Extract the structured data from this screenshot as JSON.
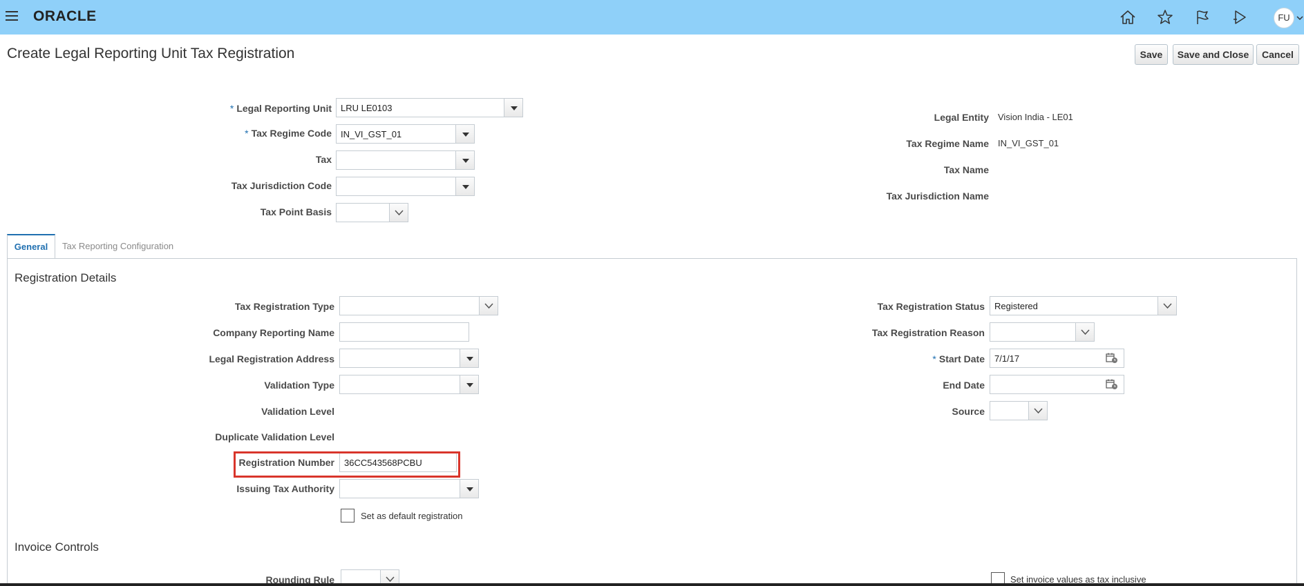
{
  "header": {
    "logo": "ORACLE",
    "avatar_initials": "FU",
    "icons": [
      "menu-icon",
      "home-icon",
      "star-icon",
      "flag-icon",
      "notifications-icon"
    ]
  },
  "page": {
    "title": "Create Legal Reporting Unit Tax Registration",
    "buttons": {
      "save": "Save",
      "save_and_close": "Save and Close",
      "cancel": "Cancel"
    }
  },
  "header_form": {
    "legal_reporting_unit": {
      "label": "Legal Reporting Unit",
      "value": "LRU LE0103",
      "required": "*"
    },
    "tax_regime_code": {
      "label": "Tax Regime Code",
      "value": "IN_VI_GST_01",
      "required": "*"
    },
    "tax": {
      "label": "Tax",
      "value": ""
    },
    "tax_jurisdiction_code": {
      "label": "Tax Jurisdiction Code",
      "value": ""
    },
    "tax_point_basis": {
      "label": "Tax Point Basis",
      "value": ""
    },
    "legal_entity": {
      "label": "Legal Entity",
      "value": "Vision India - LE01"
    },
    "tax_regime_name": {
      "label": "Tax Regime Name",
      "value": "IN_VI_GST_01"
    },
    "tax_name": {
      "label": "Tax Name",
      "value": ""
    },
    "tax_jurisdiction_name": {
      "label": "Tax Jurisdiction Name",
      "value": ""
    }
  },
  "tabs": {
    "general": "General",
    "tax_reporting_configuration": "Tax Reporting Configuration",
    "active": "General"
  },
  "registration_details": {
    "title": "Registration Details",
    "tax_registration_type": {
      "label": "Tax Registration Type",
      "value": ""
    },
    "company_reporting_name": {
      "label": "Company Reporting Name",
      "value": ""
    },
    "legal_registration_address": {
      "label": "Legal Registration Address",
      "value": ""
    },
    "validation_type": {
      "label": "Validation Type",
      "value": ""
    },
    "validation_level": {
      "label": "Validation Level",
      "value": ""
    },
    "duplicate_validation_level": {
      "label": "Duplicate Validation Level",
      "value": ""
    },
    "registration_number": {
      "label": "Registration Number",
      "value": "36CC543568PCBU"
    },
    "issuing_tax_authority": {
      "label": "Issuing Tax Authority",
      "value": ""
    },
    "set_as_default": {
      "label": "Set as default registration",
      "checked": false
    },
    "tax_registration_status": {
      "label": "Tax Registration Status",
      "value": "Registered"
    },
    "tax_registration_reason": {
      "label": "Tax Registration Reason",
      "value": ""
    },
    "start_date": {
      "label": "Start Date",
      "value": "7/1/17",
      "required": "*"
    },
    "end_date": {
      "label": "End Date",
      "value": ""
    },
    "source": {
      "label": "Source",
      "value": ""
    }
  },
  "invoice_controls": {
    "title": "Invoice Controls",
    "rounding_rule": {
      "label": "Rounding Rule",
      "value": ""
    },
    "tax_inclusive": {
      "label": "Set invoice values as tax inclusive",
      "checked": false
    }
  },
  "colors": {
    "header_bg": "#8fd0f9",
    "accent": "#1f6fb0",
    "highlight": "#d9352b"
  }
}
